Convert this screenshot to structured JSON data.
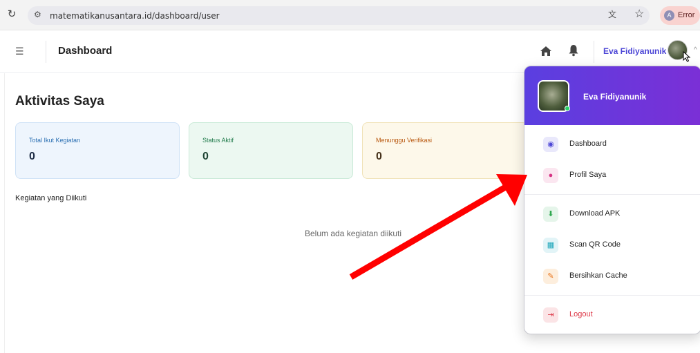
{
  "browser": {
    "url": "matematikanusantara.id/dashboard/user",
    "profile_initial": "A",
    "profile_status": "Error"
  },
  "header": {
    "title": "Dashboard",
    "user_name": "Eva Fidiyanunik"
  },
  "main": {
    "title": "Aktivitas Saya",
    "stats": [
      {
        "label": "Total Ikut Kegiatan",
        "value": "0"
      },
      {
        "label": "Status Aktif",
        "value": "0"
      },
      {
        "label": "Menunggu Verifikasi",
        "value": "0"
      }
    ],
    "section_title": "Kegiatan yang Diikuti",
    "empty_text": "Belum ada kegiatan diikuti"
  },
  "dropdown": {
    "name": "Eva Fidiyanunik",
    "items": [
      {
        "label": "Dashboard",
        "icon": "dashboard-icon",
        "color": "#4c46d6"
      },
      {
        "label": "Profil Saya",
        "icon": "user-icon",
        "color": "#d63384"
      },
      {
        "label": "Download APK",
        "icon": "download-icon",
        "color": "#2fa84f"
      },
      {
        "label": "Scan QR Code",
        "icon": "qrcode-icon",
        "color": "#16a3b8"
      },
      {
        "label": "Bersihkan Cache",
        "icon": "broom-icon",
        "color": "#e8741b"
      },
      {
        "label": "Logout",
        "icon": "logout-icon",
        "color": "#dc3545"
      }
    ]
  },
  "colors": {
    "accent": "#4c46d6",
    "annotation": "#ff0000"
  }
}
